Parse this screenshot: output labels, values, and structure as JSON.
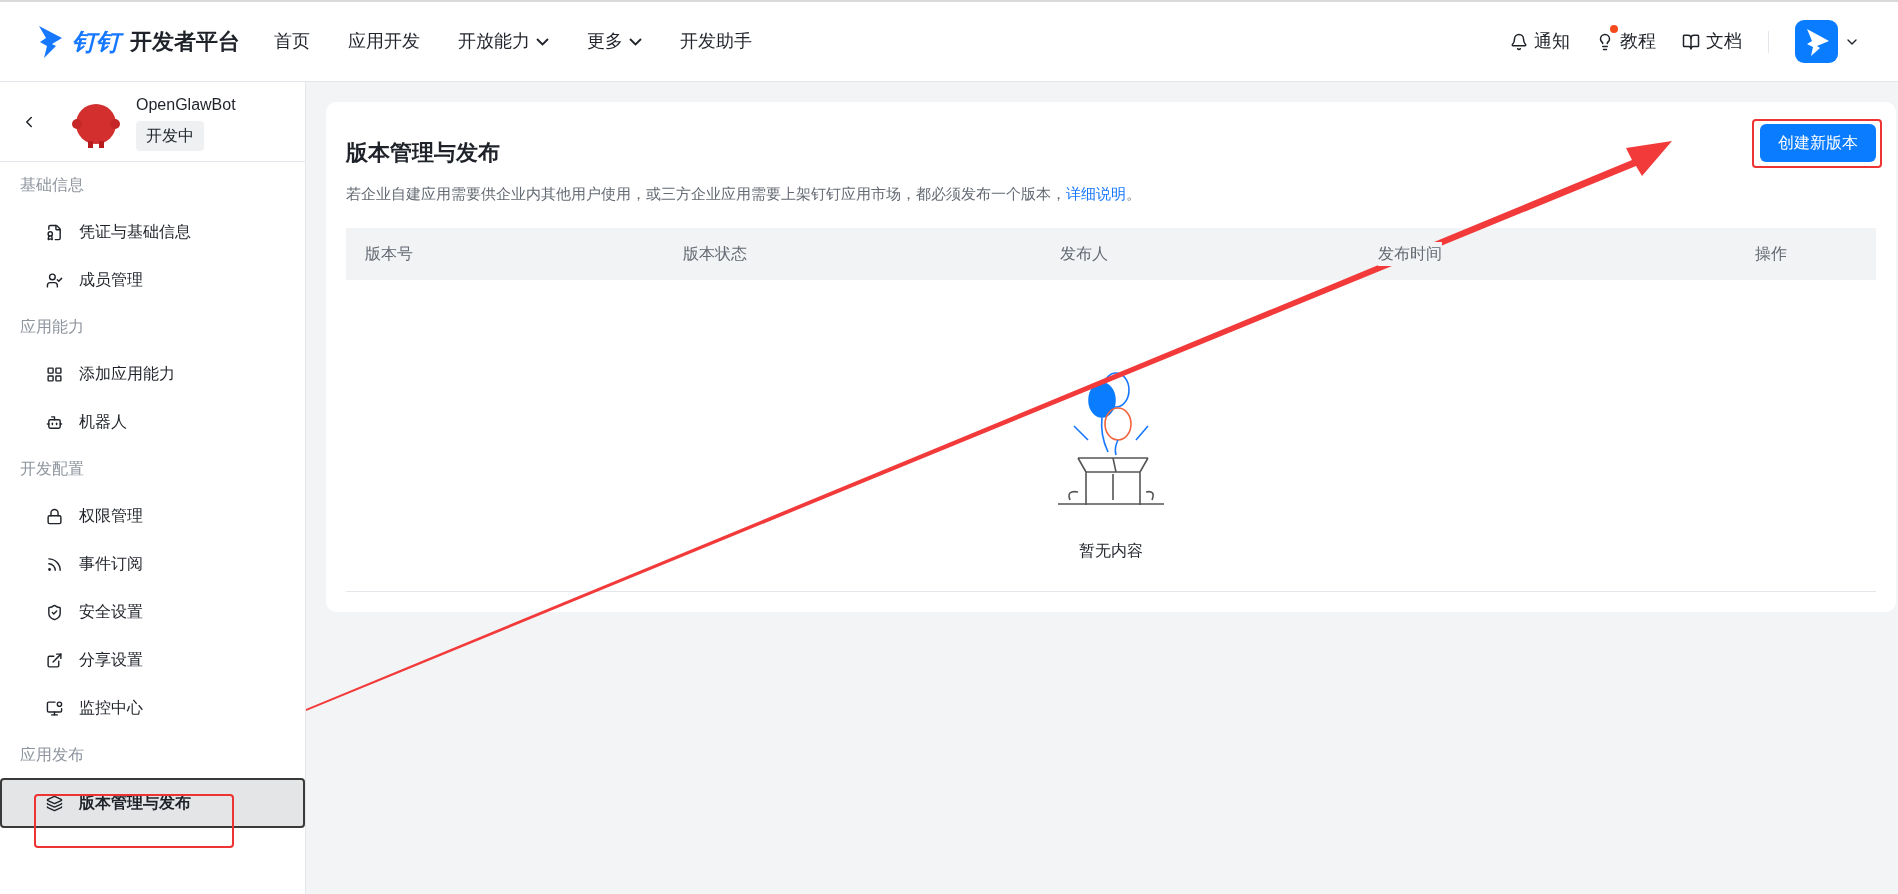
{
  "header": {
    "brand": "钉钉",
    "title": "开发者平台",
    "nav": [
      {
        "label": "首页",
        "dropdown": false
      },
      {
        "label": "应用开发",
        "dropdown": false
      },
      {
        "label": "开放能力",
        "dropdown": true
      },
      {
        "label": "更多",
        "dropdown": true
      },
      {
        "label": "开发助手",
        "dropdown": false
      }
    ],
    "actions": [
      {
        "label": "通知",
        "dot": false
      },
      {
        "label": "教程",
        "dot": true
      },
      {
        "label": "文档",
        "dot": false
      }
    ]
  },
  "app": {
    "name": "OpenGlawBot",
    "status": "开发中"
  },
  "sidebar": [
    {
      "label": "基础信息",
      "items": [
        {
          "label": "凭证与基础信息",
          "selected": false
        },
        {
          "label": "成员管理",
          "selected": false
        }
      ]
    },
    {
      "label": "应用能力",
      "items": [
        {
          "label": "添加应用能力",
          "selected": false
        },
        {
          "label": "机器人",
          "selected": false
        }
      ]
    },
    {
      "label": "开发配置",
      "items": [
        {
          "label": "权限管理",
          "selected": false
        },
        {
          "label": "事件订阅",
          "selected": false
        },
        {
          "label": "安全设置",
          "selected": false
        },
        {
          "label": "分享设置",
          "selected": false
        },
        {
          "label": "监控中心",
          "selected": false
        }
      ]
    },
    {
      "label": "应用发布",
      "items": [
        {
          "label": "版本管理与发布",
          "selected": true
        }
      ]
    }
  ],
  "page": {
    "title": "版本管理与发布",
    "create_button": "创建新版本",
    "description": "若企业自建应用需要供企业内其他用户使用，或三方企业应用需要上架钉钉应用市场，都必须发布一个版本，",
    "link": "详细说明",
    "description_end": "。",
    "table": {
      "columns": [
        "版本号",
        "版本状态",
        "发布人",
        "发布时间",
        "操作"
      ],
      "empty_text": "暂无内容"
    }
  }
}
